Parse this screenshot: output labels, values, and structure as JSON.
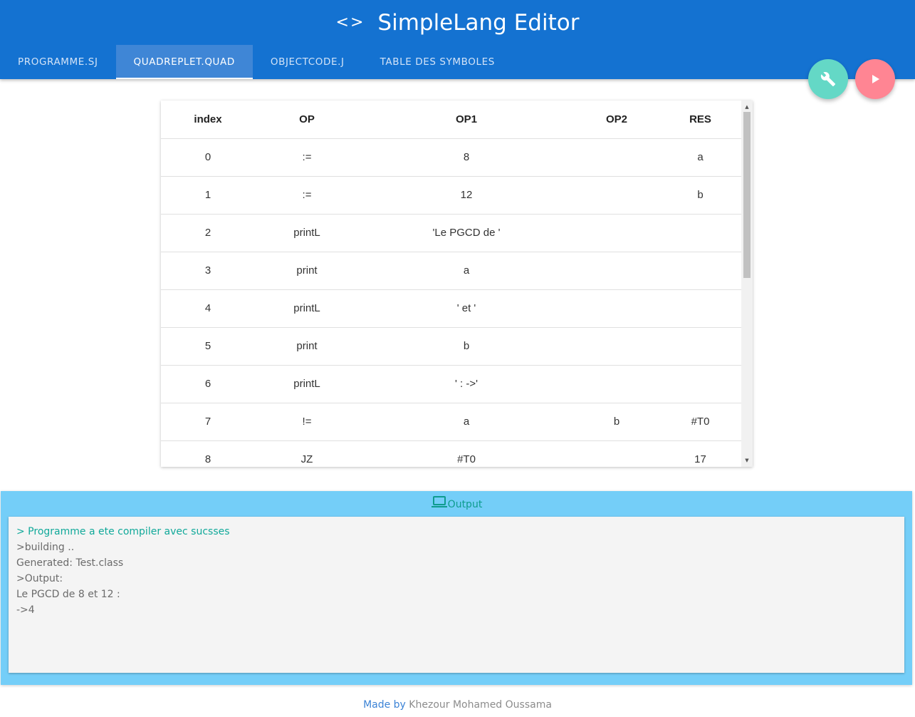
{
  "app": {
    "title": "SimpleLang Editor",
    "icon": "code-icon"
  },
  "tabs": [
    {
      "label": "PROGRAMME.SJ",
      "active": false
    },
    {
      "label": "QUADREPLET.QUAD",
      "active": true
    },
    {
      "label": "OBJECTCODE.J",
      "active": false
    },
    {
      "label": "TABLE DES SYMBOLES",
      "active": false
    }
  ],
  "fabs": {
    "tools_icon": "wrench-icon",
    "run_icon": "play-icon",
    "tools_color": "#64d8c6",
    "run_color": "#ff8593"
  },
  "quad_table": {
    "headers": [
      "index",
      "OP",
      "OP1",
      "OP2",
      "RES"
    ],
    "rows": [
      [
        "0",
        ":=",
        "8",
        "",
        "a"
      ],
      [
        "1",
        ":=",
        "12",
        "",
        "b"
      ],
      [
        "2",
        "printL",
        "'Le PGCD de '",
        "",
        ""
      ],
      [
        "3",
        "print",
        "a",
        "",
        ""
      ],
      [
        "4",
        "printL",
        "' et '",
        "",
        ""
      ],
      [
        "5",
        "print",
        "b",
        "",
        ""
      ],
      [
        "6",
        "printL",
        "' : ->'",
        "",
        ""
      ],
      [
        "7",
        "!=",
        "a",
        "b",
        "#T0"
      ],
      [
        "8",
        "JZ",
        "#T0",
        "",
        "17"
      ]
    ]
  },
  "output": {
    "title": "Output",
    "icon": "laptop-icon",
    "success_line": "> Programme a ete compiler avec sucsses",
    "lines": [
      ">building ..",
      "Generated: Test.class",
      ">Output:",
      "Le PGCD de 8 et 12 :",
      "->4"
    ]
  },
  "footer": {
    "made_by": "Made by",
    "author": "Khezour Mohamed Oussama"
  },
  "colors": {
    "header": "#1472d1",
    "active_tab": "#3f86d6",
    "output_panel": "#74cef8",
    "success_text": "#11a99a"
  }
}
